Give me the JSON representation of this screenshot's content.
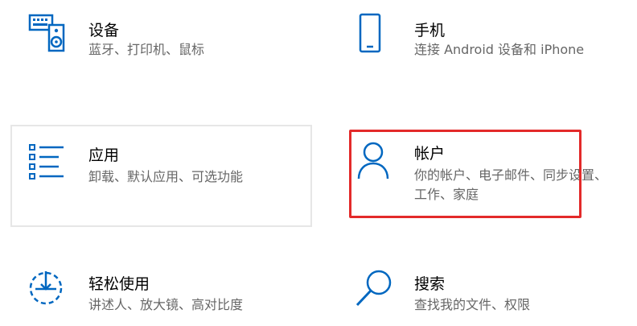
{
  "colors": {
    "accent": "#0067c0",
    "highlight": "#e32a2a",
    "title": "#000000",
    "description": "#666666"
  },
  "tiles": [
    {
      "icon": "keyboard-speaker-icon",
      "title": "设备",
      "description": "蓝牙、打印机、鼠标"
    },
    {
      "icon": "phone-icon",
      "title": "手机",
      "description": "连接 Android 设备和 iPhone"
    },
    {
      "icon": "apps-list-icon",
      "title": "应用",
      "description": "卸载、默认应用、可选功能"
    },
    {
      "icon": "person-icon",
      "title": "帐户",
      "description": "你的帐户、电子邮件、同步设置、工作、家庭"
    },
    {
      "icon": "ease-of-access-icon",
      "title": "轻松使用",
      "description": "讲述人、放大镜、高对比度"
    },
    {
      "icon": "search-icon",
      "title": "搜索",
      "description": "查找我的文件、权限"
    }
  ]
}
